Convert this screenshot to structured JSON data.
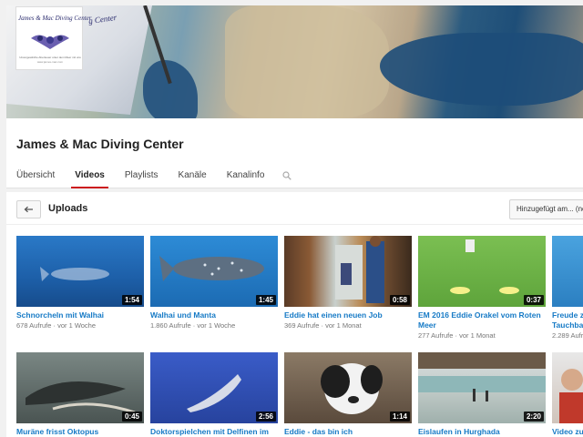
{
  "banner": {
    "logo_title": "James & Mac Diving Center",
    "logo_subtitle": "Unvergessliche Abenteuer unter dem Meer mit uns",
    "logo_url": "www.james-mac.com",
    "banner_text": "g Center"
  },
  "channel": {
    "title": "James & Mac Diving Center"
  },
  "tabs": [
    {
      "label": "Übersicht"
    },
    {
      "label": "Videos"
    },
    {
      "label": "Playlists"
    },
    {
      "label": "Kanäle"
    },
    {
      "label": "Kanalinfo"
    }
  ],
  "uploads": {
    "label": "Uploads",
    "sort_label": "Hinzugefügt am... (neueste)"
  },
  "videos": [
    {
      "title": "Schnorcheln mit Walhai",
      "views": "678 Aufrufe",
      "age": "vor 1 Woche",
      "duration": "1:54"
    },
    {
      "title": "Walhai und Manta",
      "views": "1.860 Aufrufe",
      "age": "vor 1 Woche",
      "duration": "1:45"
    },
    {
      "title": "Eddie hat einen neuen Job",
      "views": "369 Aufrufe",
      "age": "vor 1 Monat",
      "duration": "0:58"
    },
    {
      "title": "EM 2016 Eddie Orakel vom Roten Meer",
      "views": "277 Aufrufe",
      "age": "vor 1 Monat",
      "duration": "0:37"
    },
    {
      "title": "Freude z",
      "title2": "Tauchba",
      "views": "2.289 Aufr",
      "age": "",
      "duration": ""
    },
    {
      "title": "Muräne frisst Oktopus",
      "duration": "0:45"
    },
    {
      "title": "Doktorspielchen mit Delfinen im",
      "duration": "2:56"
    },
    {
      "title": "Eddie - das bin ich",
      "duration": "1:14"
    },
    {
      "title": "Eislaufen in Hurghada",
      "duration": "2:20"
    },
    {
      "title": "Video zu",
      "duration": ""
    }
  ],
  "meta_sep": "·"
}
